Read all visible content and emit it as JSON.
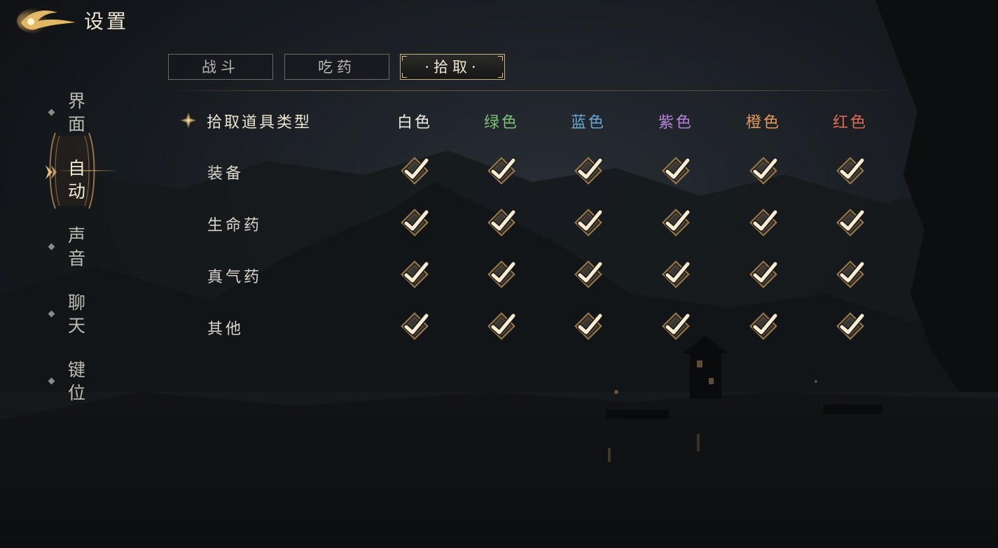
{
  "header": {
    "title": "设置"
  },
  "nav": {
    "items": [
      {
        "label": "界面",
        "active": false
      },
      {
        "label": "自动",
        "active": true
      },
      {
        "label": "声音",
        "active": false
      },
      {
        "label": "聊天",
        "active": false
      },
      {
        "label": "键位",
        "active": false
      }
    ]
  },
  "tabs": [
    {
      "label": "战斗",
      "active": false
    },
    {
      "label": "吃药",
      "active": false
    },
    {
      "label": "·拾取·",
      "active": true
    }
  ],
  "grid": {
    "header_label": "拾取道具类型",
    "columns": [
      {
        "label": "白色",
        "color": "#f0ece2"
      },
      {
        "label": "绿色",
        "color": "#7cc27a"
      },
      {
        "label": "蓝色",
        "color": "#6ba8d6"
      },
      {
        "label": "紫色",
        "color": "#b783d8"
      },
      {
        "label": "橙色",
        "color": "#e39a5c"
      },
      {
        "label": "红色",
        "color": "#de6b55"
      }
    ],
    "rows": [
      {
        "label": "装备",
        "checked": [
          true,
          true,
          true,
          true,
          true,
          true
        ]
      },
      {
        "label": "生命药",
        "checked": [
          true,
          true,
          true,
          true,
          true,
          true
        ]
      },
      {
        "label": "真气药",
        "checked": [
          true,
          true,
          true,
          true,
          true,
          true
        ]
      },
      {
        "label": "其他",
        "checked": [
          true,
          true,
          true,
          true,
          true,
          true
        ]
      }
    ]
  },
  "colors": {
    "accent": "#c9a96a",
    "check": "#f4ecd4"
  }
}
